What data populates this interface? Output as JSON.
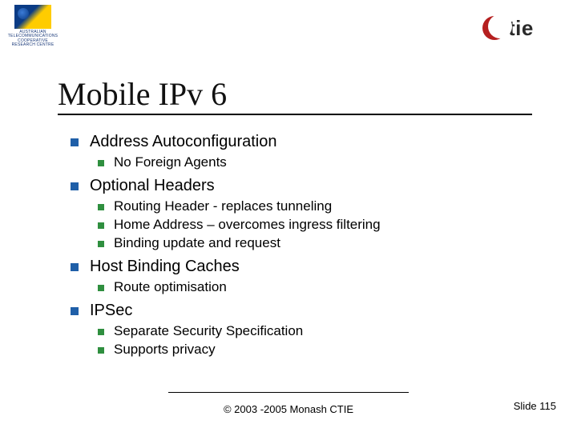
{
  "logos": {
    "left_label_line1": "AUSTRALIAN",
    "left_label_line2": "TELECOMMUNICATIONS",
    "left_label_line3": "COOPERATIVE RESEARCH CENTRE",
    "right_text": "tie"
  },
  "title": "Mobile IPv 6",
  "sections": [
    {
      "label": "Address Autoconfiguration",
      "items": [
        "No Foreign Agents"
      ]
    },
    {
      "label": "Optional Headers",
      "items": [
        "Routing Header - replaces tunneling",
        "Home Address – overcomes ingress filtering",
        "Binding update and request"
      ]
    },
    {
      "label": "Host Binding Caches",
      "items": [
        "Route optimisation"
      ]
    },
    {
      "label": "IPSec",
      "items": [
        "Separate Security Specification",
        "Supports privacy"
      ]
    }
  ],
  "footer": {
    "center": "© 2003 -2005 Monash CTIE",
    "right": "Slide 115"
  }
}
